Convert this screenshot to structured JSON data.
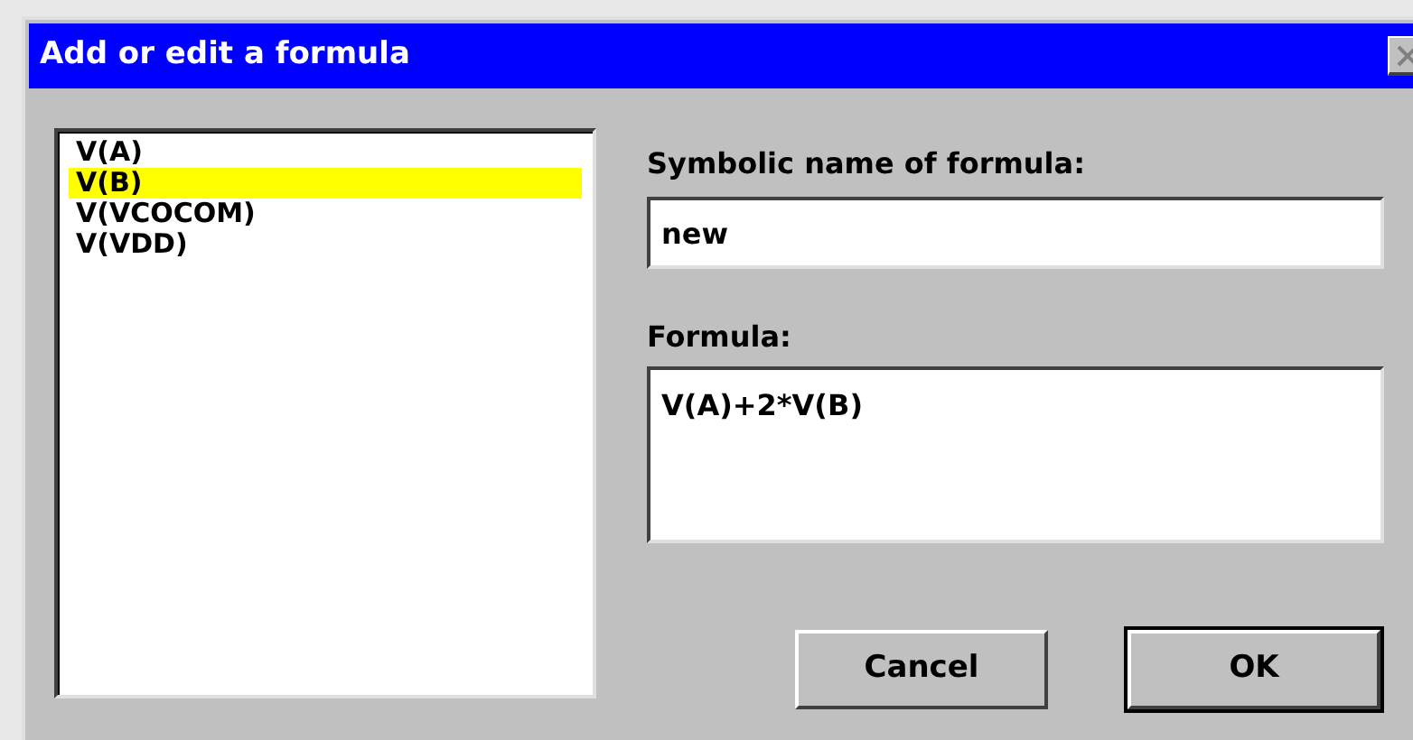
{
  "window": {
    "title": "Add or edit a formula"
  },
  "list": {
    "items": [
      {
        "label": "V(A)",
        "selected": false
      },
      {
        "label": "V(B)",
        "selected": true
      },
      {
        "label": "V(VCOCOM)",
        "selected": false
      },
      {
        "label": "V(VDD)",
        "selected": false
      }
    ]
  },
  "name_field": {
    "label": "Symbolic name of formula:",
    "value": "new"
  },
  "formula_field": {
    "label": "Formula:",
    "value": "V(A)+2*V(B)"
  },
  "buttons": [
    {
      "label": "Cancel",
      "default": false
    },
    {
      "label": "OK",
      "default": true
    }
  ]
}
